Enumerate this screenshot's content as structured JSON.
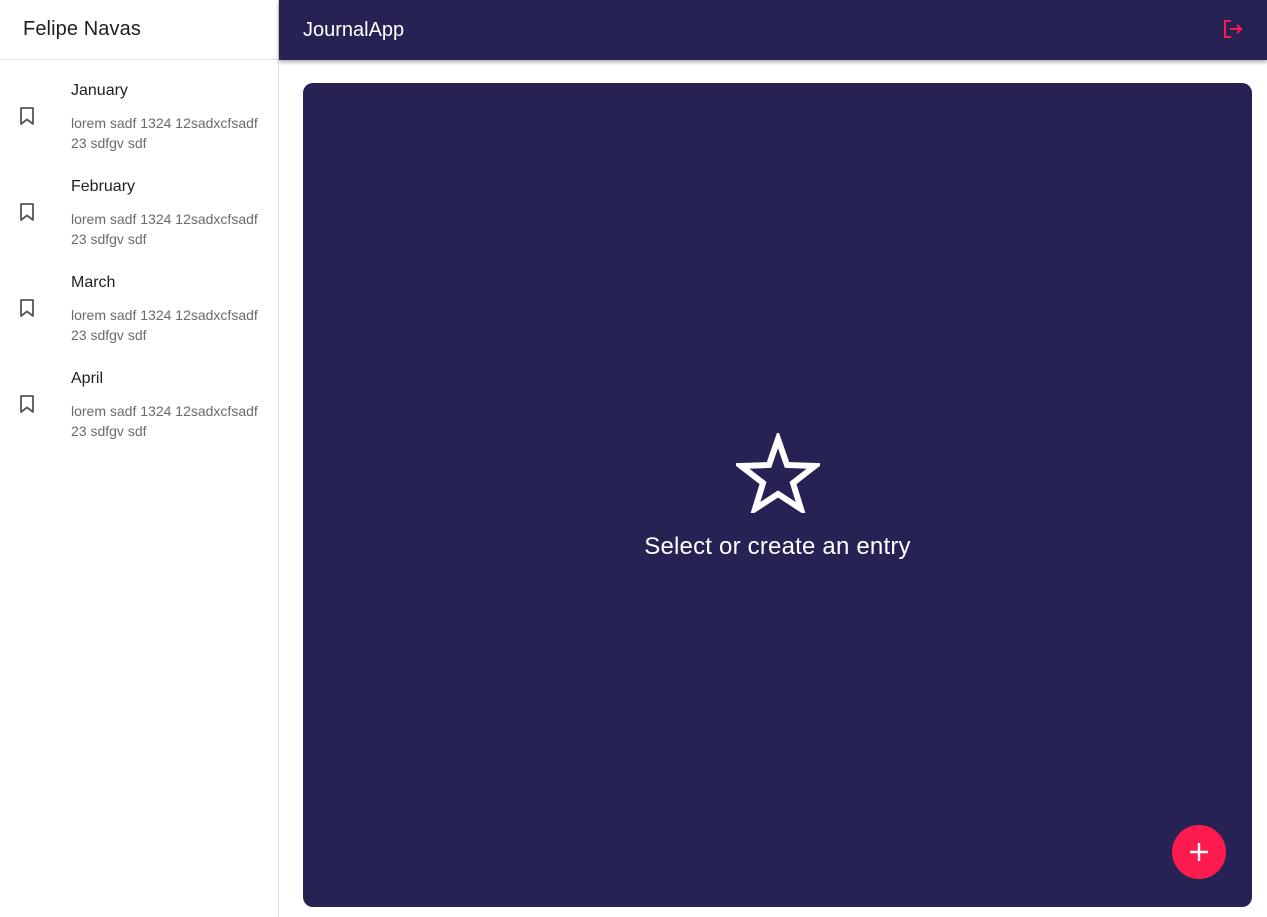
{
  "sidebar": {
    "user_name": "Felipe Navas",
    "entries": [
      {
        "title": "January",
        "body": "lorem sadf 1324 12sadxcfsadf 23 sdfgv sdf",
        "icon": "bookmark-border-icon"
      },
      {
        "title": "February",
        "body": "lorem sadf 1324 12sadxcfsadf 23 sdfgv sdf",
        "icon": "bookmark-border-icon"
      },
      {
        "title": "March",
        "body": "lorem sadf 1324 12sadxcfsadf 23 sdfgv sdf",
        "icon": "bookmark-border-icon"
      },
      {
        "title": "April",
        "body": "lorem sadf 1324 12sadxcfsadf 23 sdfgv sdf",
        "icon": "bookmark-border-icon"
      }
    ]
  },
  "topbar": {
    "title": "JournalApp",
    "logout_icon": "logout-icon"
  },
  "main": {
    "empty_icon": "star-outline-icon",
    "empty_message": "Select or create an entry",
    "fab_icon": "add-icon"
  },
  "colors": {
    "primary": "#262254",
    "accent": "#fd1b4e",
    "sidebar_bg": "#ffffff",
    "divider": "#e0e0e0"
  }
}
